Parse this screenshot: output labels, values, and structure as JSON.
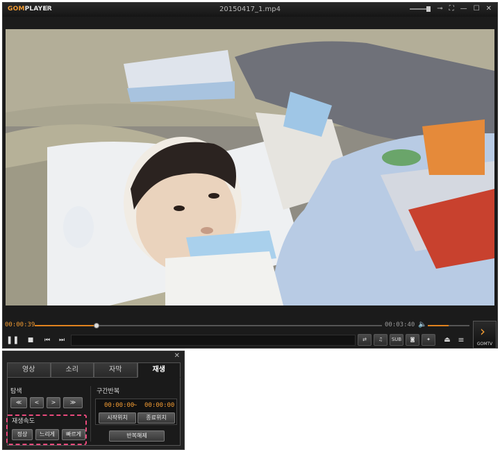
{
  "app": {
    "logo": "GOMPLAYER",
    "window_title": "20150417_1.mp4",
    "icons": [
      "settings-icon",
      "pin-icon",
      "fullscreen-icon",
      "minimize-icon",
      "maximize-icon",
      "close-icon"
    ]
  },
  "playback": {
    "current_time": "00:00:39",
    "total_time": "00:03:40",
    "progress": 0.177,
    "volume": 0.5
  },
  "controls": {
    "buttons": [
      "pause",
      "stop",
      "previous",
      "next"
    ],
    "right_buttons": [
      "subtitle-sync",
      "audio-settings",
      "SUB",
      "capture",
      "effects",
      "eject",
      "menu"
    ],
    "sub_label": "SUB",
    "gomtv_label": "GOMTV"
  },
  "panel": {
    "tabs": [
      "영상",
      "소리",
      "자막",
      "재생"
    ],
    "active_tab": "재생",
    "search": {
      "title": "탐색",
      "buttons": [
        "≪",
        "<",
        ">",
        "≫"
      ]
    },
    "speed": {
      "title": "재생속도",
      "buttons": [
        "정상",
        "느리게",
        "빠르게"
      ]
    },
    "ab_repeat": {
      "title": "구간반복",
      "start_time": "00:00:00",
      "separator": "~",
      "end_time": "00:00:00",
      "start_button": "시작위치",
      "end_button": "종료위치",
      "release_button": "반복해제"
    }
  },
  "colors": {
    "accent": "#f39c33",
    "highlight": "#e94a7c"
  }
}
